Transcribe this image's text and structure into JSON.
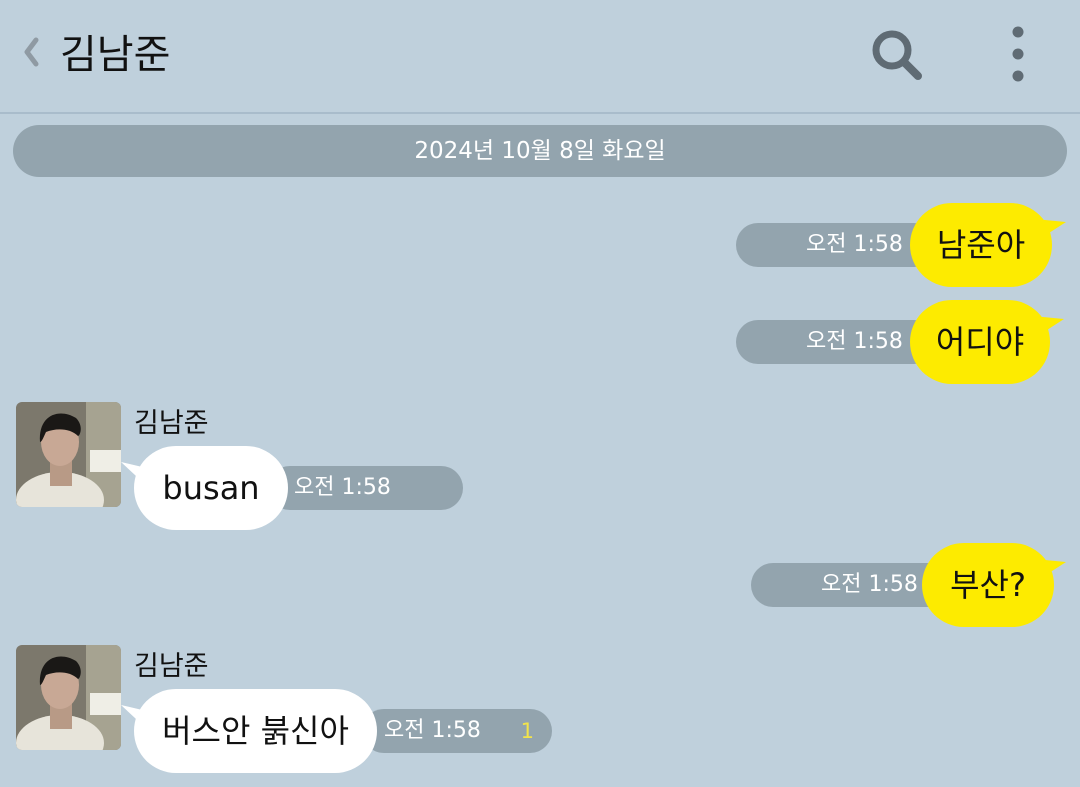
{
  "header": {
    "title": "김남준",
    "back_icon": "chevron-left-icon",
    "search_icon": "search-icon",
    "more_icon": "more-vertical-icon"
  },
  "date_divider": "2024년 10월 8일 화요일",
  "colors": {
    "background": "#bfd0dc",
    "my_bubble": "#fdeb00",
    "their_bubble": "#ffffff",
    "time_pill": "#93a4ae",
    "unread_count": "#f2e34a"
  },
  "messages": [
    {
      "sender": "me",
      "text": "남준아",
      "time": "오전 1:58"
    },
    {
      "sender": "me",
      "text": "어디야",
      "time": "오전 1:58"
    },
    {
      "sender": "김남준",
      "text": "busan",
      "time": "오전 1:58"
    },
    {
      "sender": "me",
      "text": "부산?",
      "time": "오전 1:58"
    },
    {
      "sender": "김남준",
      "text": "버스안 붉신아",
      "time": "오전 1:58",
      "unread": "1"
    }
  ]
}
